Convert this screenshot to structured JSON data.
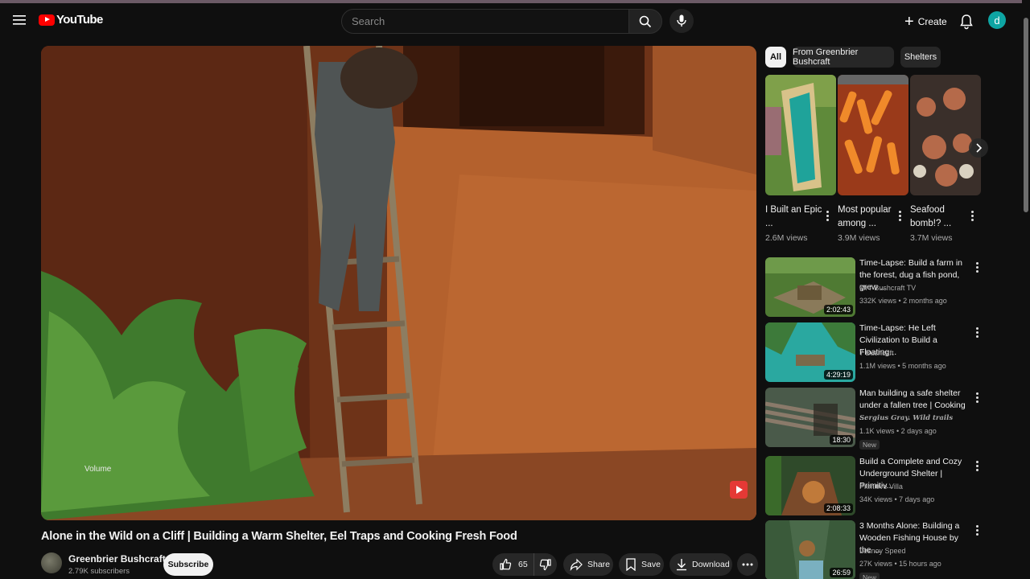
{
  "header": {
    "logo_text": "YouTube",
    "search_placeholder": "Search",
    "create_label": "Create",
    "avatar_letter": "d"
  },
  "player": {
    "volume_label": "Volume"
  },
  "video": {
    "title": "Alone in the Wild on a Cliff | Building a Warm Shelter, Eel Traps and Cooking Fresh Food",
    "channel_name": "Greenbrier Bushcraft",
    "subscribers": "2.79K subscribers",
    "subscribe_label": "Subscribe",
    "like_count": "65",
    "share_label": "Share",
    "save_label": "Save",
    "download_label": "Download"
  },
  "chips": [
    "All",
    "From Greenbrier Bushcraft",
    "Shelters"
  ],
  "shorts": [
    {
      "title": "I Built an Epic ...",
      "views": "2.6M views"
    },
    {
      "title": "Most popular among ...",
      "views": "3.9M views"
    },
    {
      "title": "Seafood bomb!? ...",
      "views": "3.7M views"
    }
  ],
  "recommended": [
    {
      "title": "Time-Lapse: Build a farm in the forest, dug a fish pond, grew ...",
      "channel": "MrT Bushcraft TV",
      "meta": "332K views • 2 months ago",
      "duration": "2:02:43",
      "badge": ""
    },
    {
      "title": "Time-Lapse: He Left Civilization to Build a Floating...",
      "channel": "7 Bushcaft",
      "meta": "1.1M views • 5 months ago",
      "duration": "4:29:19",
      "badge": ""
    },
    {
      "title": "Man building a safe shelter under a fallen tree | Cooking ...",
      "channel": "Sergius Gray. Wild trails",
      "meta": "1.1K views • 2 days ago",
      "duration": "18:30",
      "badge": "New"
    },
    {
      "title": "Build a Complete and Cozy Underground Shelter | Primitiv...",
      "channel": "Primitive Villa",
      "meta": "34K views • 7 days ago",
      "duration": "2:08:33",
      "badge": ""
    },
    {
      "title": "3 Months Alone: Building a Wooden Fishing House by the ...",
      "channel": "Lesnoy Speed",
      "meta": "27K views • 15 hours ago",
      "duration": "26:59",
      "badge": "New"
    }
  ],
  "colors": {
    "background": "#0f0f0f",
    "brand_red": "#ff0000",
    "avatar_teal": "#0ea5a3",
    "chip_bg": "#272727"
  }
}
